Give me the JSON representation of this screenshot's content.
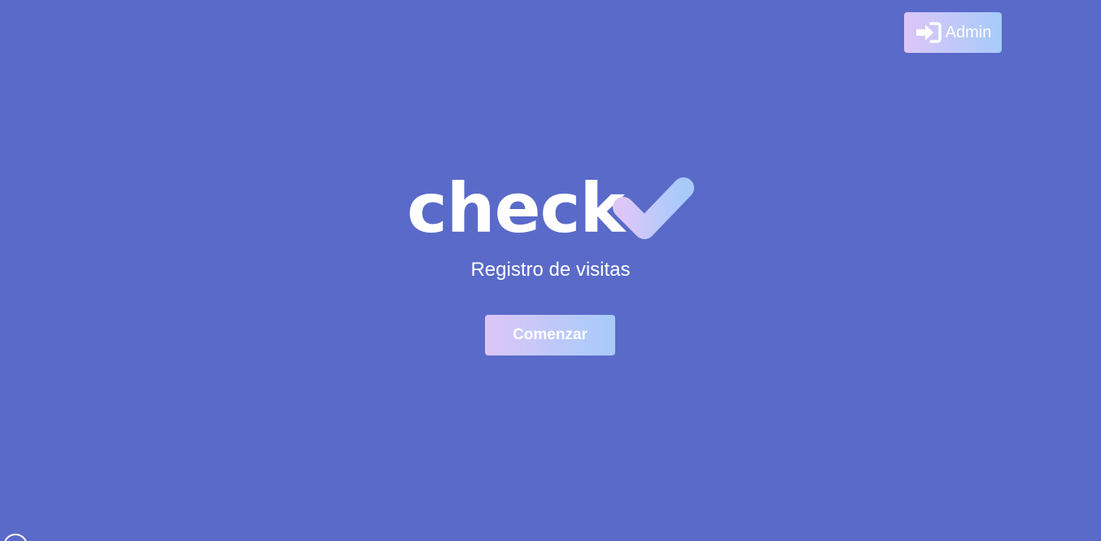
{
  "header": {
    "admin_button": {
      "label": "Admin",
      "icon": "sign-in-icon"
    }
  },
  "hero": {
    "logo": {
      "word": "check",
      "mark_icon": "checkmark-icon"
    },
    "subtitle": "Registro de visitas",
    "start_button": "Comenzar"
  },
  "colors": {
    "background": "#5a6ac8",
    "gradient_start": "#dcc6f8",
    "gradient_end": "#a6cbfa",
    "text": "#ffffff"
  }
}
